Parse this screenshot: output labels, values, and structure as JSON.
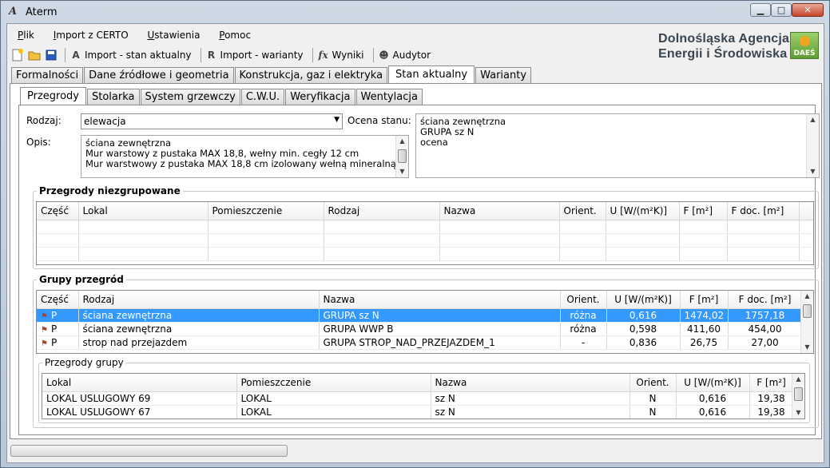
{
  "window": {
    "title": "Aterm",
    "min_label": "▁",
    "max_label": "□",
    "close_label": "✕"
  },
  "menu": [
    {
      "u": "P",
      "rest": "lik"
    },
    {
      "u": "I",
      "rest": "mport z CERTO"
    },
    {
      "u": "U",
      "rest": "stawienia"
    },
    {
      "u": "P",
      "rest": "omoc"
    }
  ],
  "toolbar": {
    "import_current": "Import - stan aktualny",
    "import_variants": "Import - warianty",
    "results": "Wyniki",
    "auditor": "Audytor"
  },
  "brand": {
    "line1": "Dolnośląska Agencja",
    "line2": "Energii i Środowiska",
    "logo": "DAEŚ"
  },
  "main_tabs": [
    "Formalności",
    "Dane źródłowe i geometria",
    "Konstrukcja, gaz i elektryka",
    "Stan aktualny",
    "Warianty"
  ],
  "sub_tabs": [
    "Przegrody",
    "Stolarka",
    "System grzewczy",
    "C.W.U.",
    "Weryfikacja",
    "Wentylacja"
  ],
  "form": {
    "rodzaj_label": "Rodzaj:",
    "rodzaj_value": "elewacja",
    "opis_label": "Opis:",
    "opis_lines": [
      "ściana zewnętrzna",
      "Mur warstowy z pustaka MAX 18,8, wełny min. cegły 12 cm",
      "Mur warstwowy z pustaka MAX 18,8 cm izolowany wełną mineralną"
    ],
    "ocena_label": "Ocena stanu:",
    "ocena_lines": [
      "ściana zewnętrzna",
      "GRUPA sz N",
      "ocena"
    ]
  },
  "ungrouped": {
    "title": "Przegrody niezgrupowane",
    "columns": [
      "Część",
      "Lokal",
      "Pomieszczenie",
      "Rodzaj",
      "Nazwa",
      "Orient.",
      "U [W/(m²K)]",
      "F [m²]",
      "F doc. [m²]"
    ]
  },
  "groups": {
    "title": "Grupy przegród",
    "columns": [
      "Część",
      "Rodzaj",
      "Nazwa",
      "Orient.",
      "U [W/(m²K)]",
      "F [m²]",
      "F doc. [m²]"
    ],
    "rows": [
      {
        "part": "P",
        "kind": "ściana zewnętrzna",
        "name": "GRUPA sz N",
        "orient": "różna",
        "u": "0,616",
        "f": "1474,02",
        "fdoc": "1757,18"
      },
      {
        "part": "P",
        "kind": "ściana zewnętrzna",
        "name": "GRUPA WWP B",
        "orient": "różna",
        "u": "0,598",
        "f": "411,60",
        "fdoc": "454,00"
      },
      {
        "part": "P",
        "kind": "strop nad przejazdem",
        "name": "GRUPA STROP_NAD_PRZEJAZDEM_1",
        "orient": "-",
        "u": "0,836",
        "f": "26,75",
        "fdoc": "27,00"
      }
    ]
  },
  "group_items": {
    "title": "Przegrody grupy",
    "columns": [
      "Lokal",
      "Pomieszczenie",
      "Nazwa",
      "Orient.",
      "U [W/(m²K)]",
      "F [m²]"
    ],
    "rows": [
      {
        "lokal": "LOKAL USLUGOWY 69",
        "room": "LOKAL",
        "name": "sz N",
        "orient": "N",
        "u": "0,616",
        "f": "19,38"
      },
      {
        "lokal": "LOKAL USLUGOWY 67",
        "room": "LOKAL",
        "name": "sz N",
        "orient": "N",
        "u": "0,616",
        "f": "19,38"
      }
    ]
  }
}
